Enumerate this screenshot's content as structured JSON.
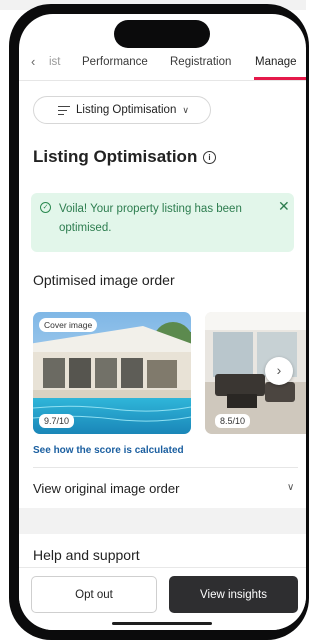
{
  "colors": {
    "accent": "#e5194a",
    "success_bg": "#e2f6ea",
    "success_text": "#2d7d4f",
    "link": "#1b5fa0",
    "dark_button": "#2e2e30"
  },
  "tabs": {
    "back_icon": "chevron-left-icon",
    "items": [
      "ist",
      "Performance",
      "Registration",
      "Manage"
    ],
    "active": "Manage"
  },
  "dropdown": {
    "label": "Listing Optimisation",
    "icon": "list-icon",
    "chevron": "chevron-down-icon"
  },
  "page": {
    "title": "Listing Optimisation",
    "info_icon": "info-icon"
  },
  "alert": {
    "message": "Voila! Your property listing has been optimised.",
    "check_icon": "check-circle-icon",
    "close_icon": "close-icon"
  },
  "optimised": {
    "title": "Optimised image order",
    "images": [
      {
        "chip": "Cover image",
        "score": "9.7/10"
      },
      {
        "score": "8.5/10"
      }
    ],
    "next_icon": "chevron-right-icon",
    "link": "See how the score is calculated"
  },
  "original": {
    "label": "View original image order",
    "chevron": "chevron-down-icon"
  },
  "help": {
    "title": "Help and support"
  },
  "actions": {
    "opt_out": "Opt out",
    "view_insights": "View insights"
  }
}
